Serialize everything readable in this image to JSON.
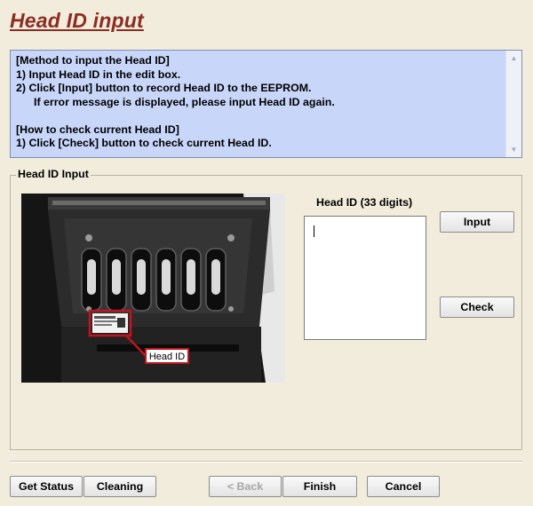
{
  "page": {
    "title": "Head ID input"
  },
  "instructions": {
    "lines": [
      "[Method to input the Head ID]",
      "1) Input Head ID in the edit box.",
      "2) Click [Input] button to record Head ID to the EEPROM.",
      "If error message is displayed, please input Head ID again.",
      "",
      "[How to check current Head ID]",
      "1) Click [Check] button to check current Head ID."
    ]
  },
  "group": {
    "label": "Head ID Input",
    "photo_callout": "Head ID",
    "field_label": "Head ID (33 digits)",
    "field_value": "",
    "input_button": "Input",
    "check_button": "Check"
  },
  "footer": {
    "get_status": "Get Status",
    "cleaning": "Cleaning",
    "back": "< Back",
    "finish": "Finish",
    "cancel": "Cancel"
  },
  "colors": {
    "title": "#8b2d22",
    "instructions_bg": "#c8d6fa",
    "window_bg": "#f1ecdc",
    "callout_border": "#c2141c"
  }
}
